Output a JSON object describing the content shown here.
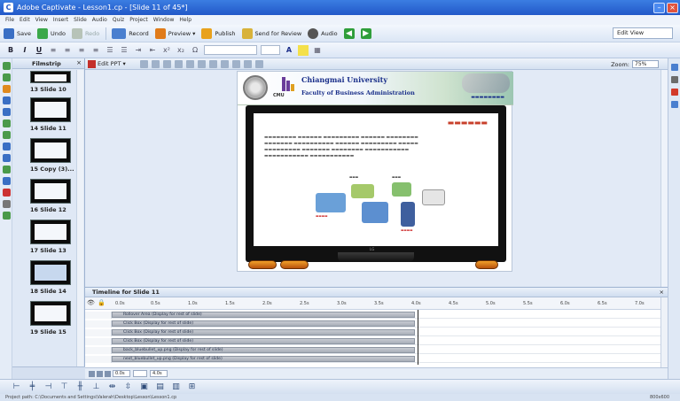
{
  "window": {
    "title": "Adobe Captivate - Lesson1.cp - [Slide 11 of 45*]"
  },
  "menu": [
    "File",
    "Edit",
    "View",
    "Insert",
    "Slide",
    "Audio",
    "Quiz",
    "Project",
    "Window",
    "Help"
  ],
  "toolbar": {
    "save": "Save",
    "undo": "Undo",
    "redo": "Redo",
    "record": "Record",
    "preview": "Preview",
    "publish": "Publish",
    "send_for_review": "Send for Review",
    "audio": "Audio",
    "view_mode": "Edit View"
  },
  "format_bar": {
    "bold": "B",
    "italic": "I",
    "underline": "U",
    "omega": "Ω"
  },
  "filmstrip": {
    "title": "Filmstrip",
    "slides": [
      {
        "label": "13 Slide 10"
      },
      {
        "label": "14 Slide 11"
      },
      {
        "label": "15 Copy (3)..."
      },
      {
        "label": "16 Slide 12"
      },
      {
        "label": "17 Slide 13"
      },
      {
        "label": "18 Slide 14"
      },
      {
        "label": "19 Slide 15"
      }
    ]
  },
  "editor": {
    "edit_ppt": "Edit PPT",
    "zoom_label": "Zoom:",
    "zoom_value": "75%"
  },
  "slide": {
    "university": "Chiangmai University",
    "faculty": "Faculty of Business Administration",
    "cmu_mark": "CMU",
    "tv_brand": "LG"
  },
  "timeline": {
    "title": "Timeline for Slide 11",
    "ticks": [
      "0.0s",
      "0.5s",
      "1.0s",
      "1.5s",
      "2.0s",
      "2.5s",
      "3.0s",
      "3.5s",
      "4.0s",
      "4.5s",
      "5.0s",
      "5.5s",
      "6.0s",
      "6.5s",
      "7.0s"
    ],
    "rows": [
      "Rollover Area (Display for rest of slide)",
      "Click Box (Display for rest of slide)",
      "Click Box (Display for rest of slide)",
      "Click Box (Display for rest of slide)",
      "back_bluebullet_up.png (Display for rest of slide)",
      "next_bluebullet_up.png (Display for rest of slide)"
    ],
    "footer_time": "0.0s",
    "footer_duration": "4.0s"
  },
  "status": {
    "path": "Project path: C:\\Documents and Settings\\Valerah\\Desktop\\Lesson\\Lesson1.cp",
    "resolution": "800x600"
  },
  "colors": {
    "title_bar": "#2258c8",
    "timeline_bar": "#a8aeb8",
    "slide_title": "#c8402b",
    "button_orange": "#e08a1e"
  }
}
